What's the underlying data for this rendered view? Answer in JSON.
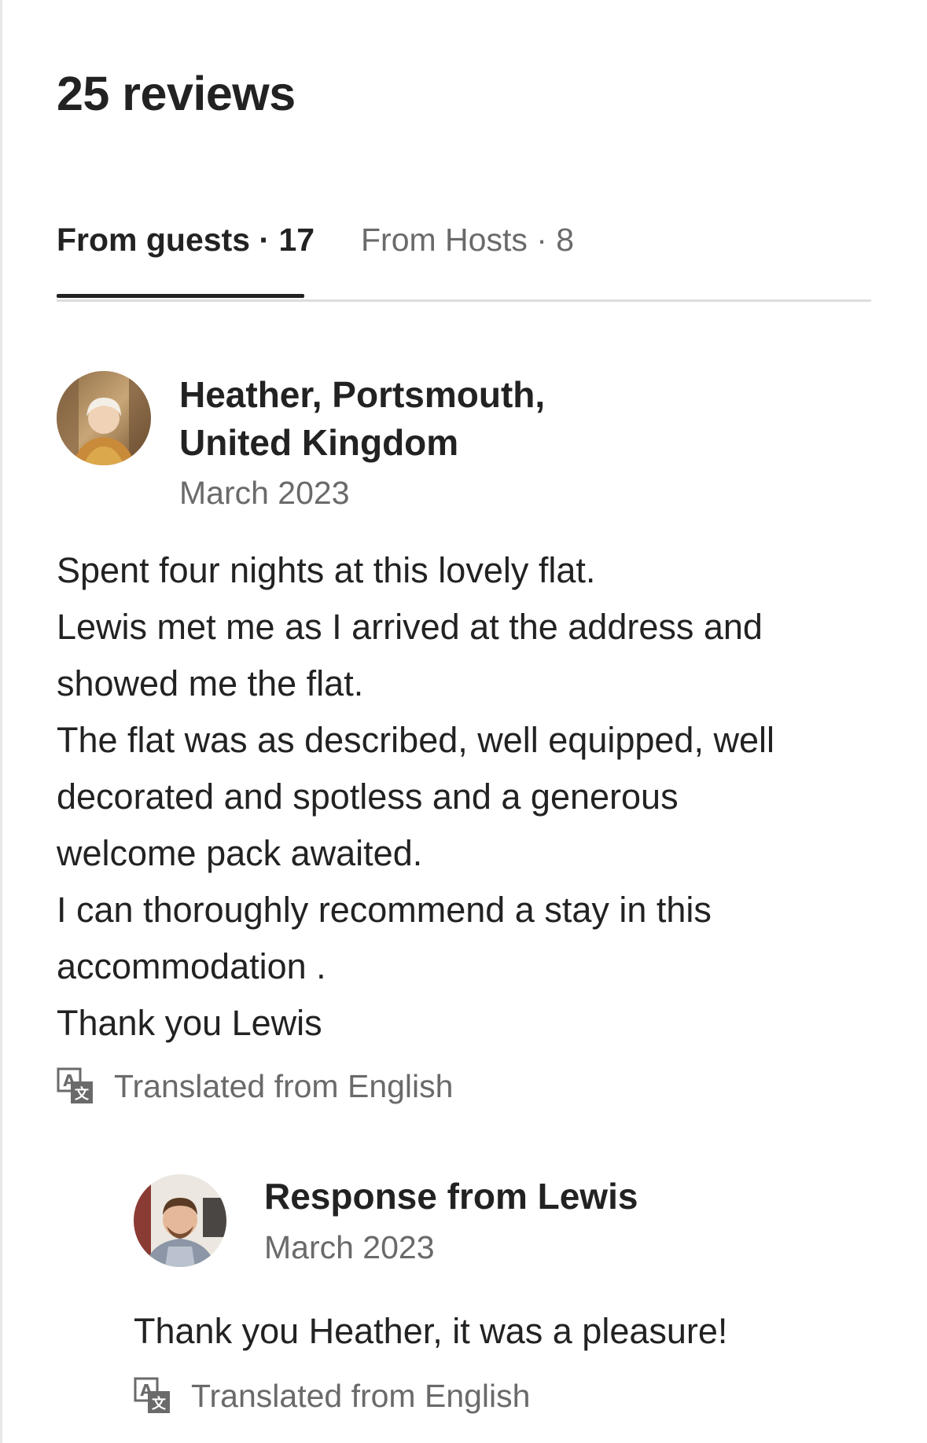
{
  "reviews": {
    "heading": "25 reviews",
    "tabs": [
      {
        "label": "From guests · 17",
        "active": true
      },
      {
        "label": "From Hosts · 8",
        "active": false
      }
    ]
  },
  "review": {
    "reviewer": {
      "name_line1": "Heather, Portsmouth,",
      "name_line2": "United Kingdom",
      "date": "March 2023"
    },
    "body_lines": [
      "Spent four nights at this lovely flat.",
      "Lewis met me as I arrived at the address and",
      "showed me the flat.",
      "The flat was as described, well equipped, well",
      "decorated and spotless and a generous",
      "welcome pack awaited.",
      "I can thoroughly recommend a stay in this",
      "accommodation .",
      "Thank you Lewis"
    ],
    "translated_label": "Translated from English",
    "translate_icon": "translate-icon"
  },
  "response": {
    "title": "Response from Lewis",
    "date": "March 2023",
    "body": "Thank you Heather, it was a pleasure!",
    "translated_label": "Translated from English",
    "translate_icon": "translate-icon"
  },
  "colors": {
    "primary_text": "#222222",
    "secondary_text": "#6a6a6a",
    "divider": "#dddddd"
  }
}
